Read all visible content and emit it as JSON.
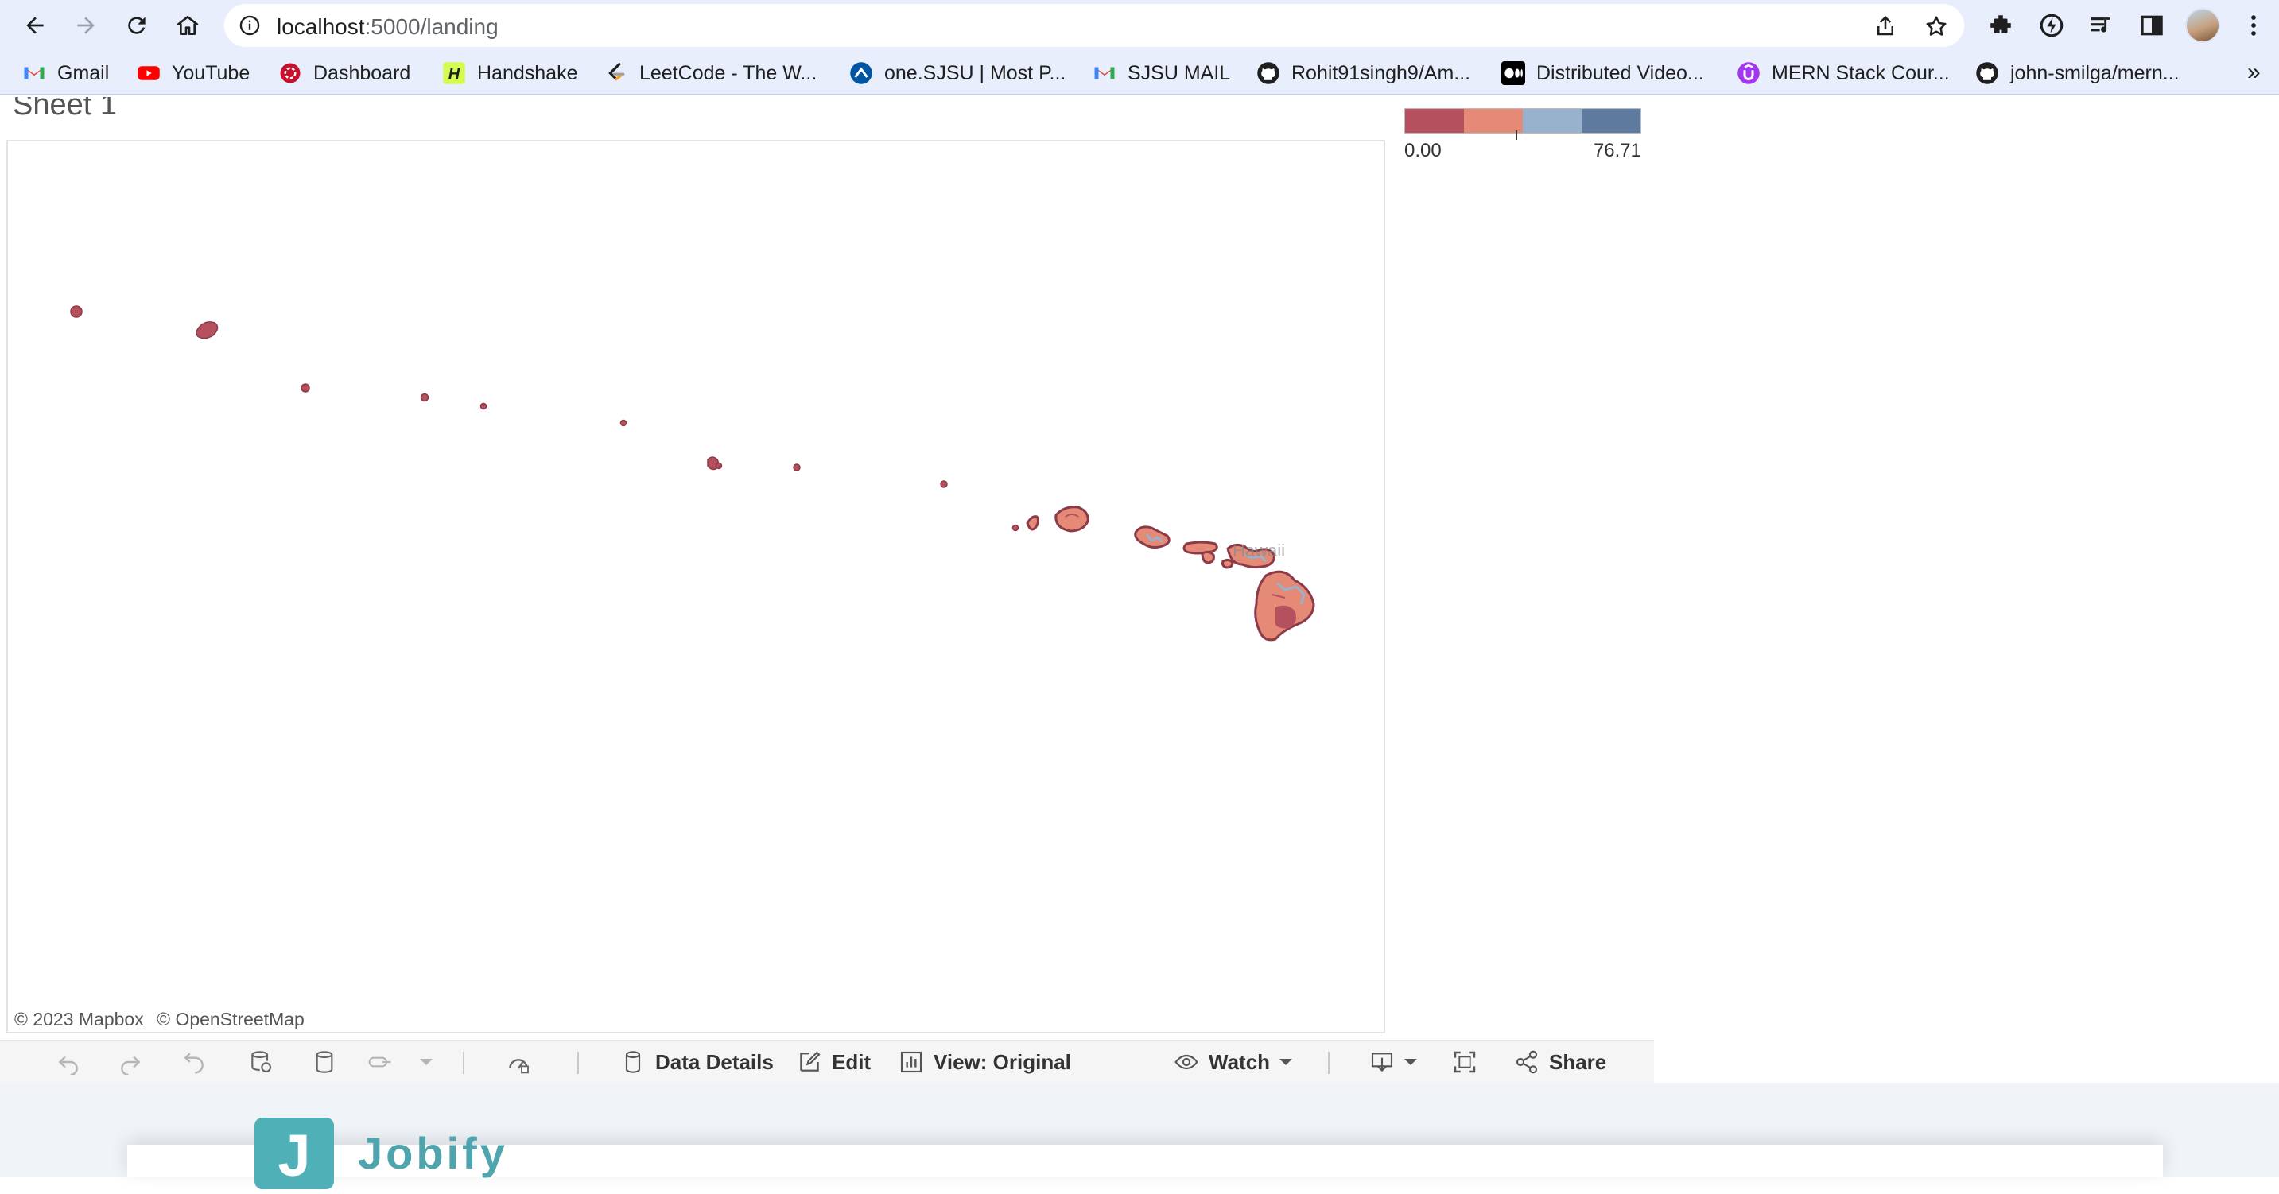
{
  "browser": {
    "url_host": "localhost",
    "url_path": ":5000/landing",
    "bookmarks": [
      {
        "label": "Gmail",
        "icon": "gmail-icon"
      },
      {
        "label": "YouTube",
        "icon": "youtube-icon"
      },
      {
        "label": "Dashboard",
        "icon": "dashboard-icon"
      },
      {
        "label": "Handshake",
        "icon": "handshake-icon"
      },
      {
        "label": "LeetCode - The W...",
        "icon": "leetcode-icon"
      },
      {
        "label": "one.SJSU | Most P...",
        "icon": "sjsu-icon"
      },
      {
        "label": "SJSU MAIL",
        "icon": "gmail-icon"
      },
      {
        "label": "Rohit91singh9/Am...",
        "icon": "github-icon"
      },
      {
        "label": "Distributed Video...",
        "icon": "medium-icon"
      },
      {
        "label": "MERN Stack Cour...",
        "icon": "udemy-icon"
      },
      {
        "label": "john-smilga/mern...",
        "icon": "github-icon"
      }
    ],
    "more": "»"
  },
  "viz": {
    "sheet_title": "Sheet 1",
    "map_label": "Hawaii",
    "attribution": [
      "© 2023 Mapbox",
      "© OpenStreetMap"
    ],
    "legend": {
      "min": "0.00",
      "max": "76.71",
      "colors": [
        "#b5505e",
        "#e58a77",
        "#98b1cc",
        "#5f7a9f"
      ]
    }
  },
  "tableau_toolbar": {
    "data_details": "Data Details",
    "edit": "Edit",
    "view": "View: Original",
    "watch": "Watch",
    "share": "Share"
  },
  "app": {
    "logo_letter": "J",
    "logo_text": "Jobify"
  }
}
